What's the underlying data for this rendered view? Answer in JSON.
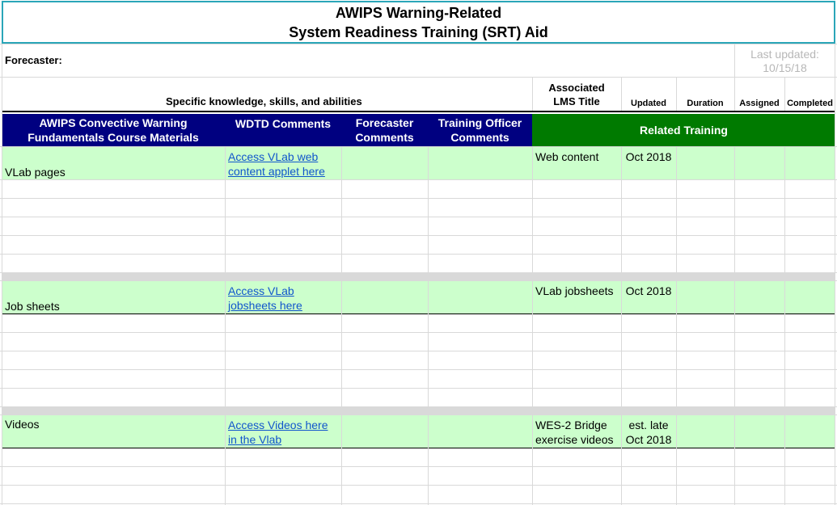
{
  "header": {
    "title_line1": "AWIPS Warning-Related",
    "title_line2": "System Readiness Training (SRT) Aid",
    "forecaster_label": "Forecaster:",
    "last_updated_label": "Last updated:",
    "last_updated_date": "10/15/18"
  },
  "subheader": {
    "ksa": "Specific knowledge, skills, and abilities",
    "lms_line1": "Associated",
    "lms_line2": "LMS Title",
    "updated": "Updated",
    "duration": "Duration",
    "assigned": "Assigned",
    "completed": "Completed"
  },
  "columns": {
    "materials_line1": "AWIPS Convective Warning",
    "materials_line2": "Fundamentals Course Materials",
    "wdtd_comments": "WDTD Comments",
    "forecaster_line1": "Forecaster",
    "forecaster_line2": "Comments",
    "training_officer_line1": "Training Officer",
    "training_officer_line2": "Comments",
    "related_training": "Related Training"
  },
  "rows": [
    {
      "material": "VLab pages",
      "link_line1": "Access VLab web",
      "link_line2": "content applet here",
      "lms_line1": "Web content",
      "lms_line2": "",
      "updated_line1": "Oct 2018",
      "updated_line2": ""
    },
    {
      "material": "Job sheets",
      "link_line1": "Access VLab",
      "link_line2": "jobsheets here",
      "lms_line1": "VLab jobsheets",
      "lms_line2": "",
      "updated_line1": "Oct 2018",
      "updated_line2": ""
    },
    {
      "material": "Videos",
      "link_line1": "Access Videos here",
      "link_line2": "in the Vlab",
      "lms_line1": "WES-2 Bridge",
      "lms_line2": "exercise videos",
      "updated_line1": "est. late",
      "updated_line2": "Oct 2018"
    }
  ]
}
